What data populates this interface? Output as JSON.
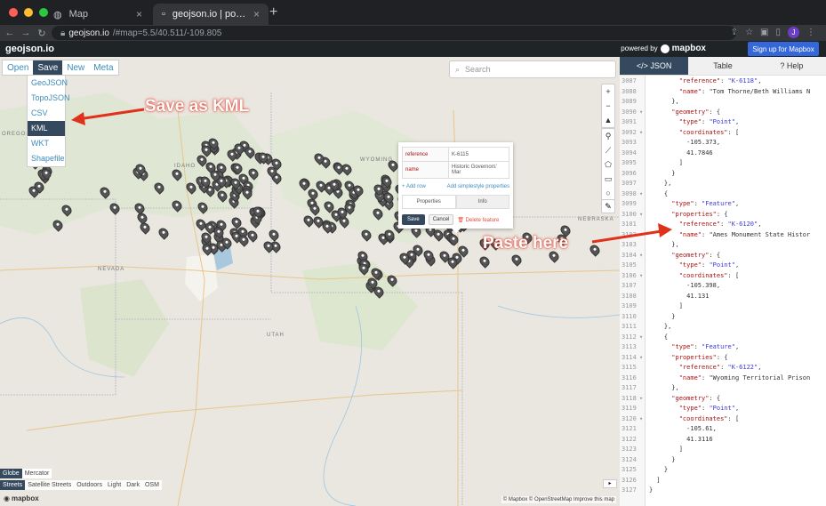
{
  "browser": {
    "tabs": [
      {
        "title": "Map",
        "active": false
      },
      {
        "title": "geojson.io | powered by Mapbox",
        "active": true
      }
    ],
    "url_host": "geojson.io",
    "url_rest": "/#map=5.5/40.511/-109.805"
  },
  "app": {
    "logo": "geojson.io",
    "powered_by": "powered by",
    "mapbox": "mapbox",
    "signup": "Sign up for Mapbox"
  },
  "menu": {
    "items": [
      "Open",
      "Save",
      "New",
      "Meta"
    ],
    "save_options": [
      "GeoJSON",
      "TopoJSON",
      "CSV",
      "KML",
      "WKT",
      "Shapefile"
    ]
  },
  "search": {
    "placeholder": "Search"
  },
  "tools": {
    "zoom_in": "+",
    "zoom_out": "−",
    "compass": "▲"
  },
  "popup": {
    "rows": [
      {
        "key": "reference",
        "value": "K-6115"
      },
      {
        "key": "name",
        "value": "Historic Governors' Mar"
      }
    ],
    "add_row": "+ Add row",
    "add_simplestyle": "Add simplestyle properties",
    "tabs": [
      "Properties",
      "Info"
    ],
    "save": "Save",
    "cancel": "Cancel",
    "delete": "Delete feature"
  },
  "annotations": {
    "save_as_kml": "Save as KML",
    "paste_here": "Paste here"
  },
  "map_labels": {
    "oregon": "OREGON",
    "idaho": "IDAHO",
    "wyoming": "WYOMING",
    "nevada": "NEVADA",
    "nebraska": "NEBRASKA",
    "utah": "UTAH"
  },
  "map_footer": {
    "projections": [
      "Globe",
      "Mercator"
    ],
    "styles": [
      "Streets",
      "Satellite Streets",
      "Outdoors",
      "Light",
      "Dark",
      "OSM"
    ],
    "attribution": "© Mapbox © OpenStreetMap  Improve this map",
    "mapbox_logo": "mapbox"
  },
  "panel": {
    "tabs": [
      "</> JSON",
      "Table",
      "? Help"
    ]
  },
  "code_lines": [
    {
      "n": "3087",
      "f": "",
      "t": "        \"reference\": \"K-6118\","
    },
    {
      "n": "3088",
      "f": "",
      "t": "        \"name\": \"Tom Thorne/Beth Williams N"
    },
    {
      "n": "3089",
      "f": "",
      "t": "      },"
    },
    {
      "n": "3090",
      "f": "▾",
      "t": "      \"geometry\": {"
    },
    {
      "n": "3091",
      "f": "",
      "t": "        \"type\": \"Point\","
    },
    {
      "n": "3092",
      "f": "▾",
      "t": "        \"coordinates\": ["
    },
    {
      "n": "3093",
      "f": "",
      "t": "          -105.373,"
    },
    {
      "n": "3094",
      "f": "",
      "t": "          41.7846"
    },
    {
      "n": "3095",
      "f": "",
      "t": "        ]"
    },
    {
      "n": "3096",
      "f": "",
      "t": "      }"
    },
    {
      "n": "3097",
      "f": "",
      "t": "    },"
    },
    {
      "n": "3098",
      "f": "▾",
      "t": "    {"
    },
    {
      "n": "3099",
      "f": "",
      "t": "      \"type\": \"Feature\","
    },
    {
      "n": "3100",
      "f": "▾",
      "t": "      \"properties\": {"
    },
    {
      "n": "3101",
      "f": "",
      "t": "        \"reference\": \"K-6120\","
    },
    {
      "n": "3102",
      "f": "",
      "t": "        \"name\": \"Ames Monument State Histor"
    },
    {
      "n": "3103",
      "f": "",
      "t": "      },"
    },
    {
      "n": "3104",
      "f": "▾",
      "t": "      \"geometry\": {"
    },
    {
      "n": "3105",
      "f": "",
      "t": "        \"type\": \"Point\","
    },
    {
      "n": "3106",
      "f": "▾",
      "t": "        \"coordinates\": ["
    },
    {
      "n": "3107",
      "f": "",
      "t": "          -105.398,"
    },
    {
      "n": "3108",
      "f": "",
      "t": "          41.131"
    },
    {
      "n": "3109",
      "f": "",
      "t": "        ]"
    },
    {
      "n": "3110",
      "f": "",
      "t": "      }"
    },
    {
      "n": "3111",
      "f": "",
      "t": "    },"
    },
    {
      "n": "3112",
      "f": "▾",
      "t": "    {"
    },
    {
      "n": "3113",
      "f": "",
      "t": "      \"type\": \"Feature\","
    },
    {
      "n": "3114",
      "f": "▾",
      "t": "      \"properties\": {"
    },
    {
      "n": "3115",
      "f": "",
      "t": "        \"reference\": \"K-6122\","
    },
    {
      "n": "3116",
      "f": "",
      "t": "        \"name\": \"Wyoming Territorial Prison"
    },
    {
      "n": "3117",
      "f": "",
      "t": "      },"
    },
    {
      "n": "3118",
      "f": "▾",
      "t": "      \"geometry\": {"
    },
    {
      "n": "3119",
      "f": "",
      "t": "        \"type\": \"Point\","
    },
    {
      "n": "3120",
      "f": "▾",
      "t": "        \"coordinates\": ["
    },
    {
      "n": "3121",
      "f": "",
      "t": "          -105.61,"
    },
    {
      "n": "3122",
      "f": "",
      "t": "          41.3116"
    },
    {
      "n": "3123",
      "f": "",
      "t": "        ]"
    },
    {
      "n": "3124",
      "f": "",
      "t": "      }"
    },
    {
      "n": "3125",
      "f": "",
      "t": "    }"
    },
    {
      "n": "3126",
      "f": "",
      "t": "  ]"
    },
    {
      "n": "3127",
      "f": "",
      "t": "}"
    }
  ],
  "colors": {
    "accent": "#34495e",
    "annotation": "#e0311b",
    "signup": "#3467d9"
  }
}
